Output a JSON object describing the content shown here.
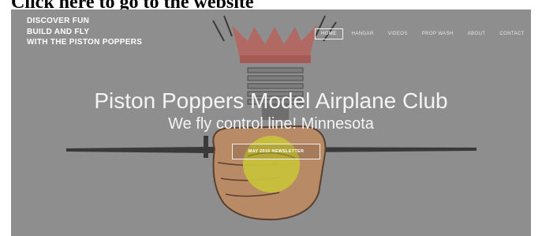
{
  "page_top_text": "Click here to go to the website",
  "header": {
    "tagline_lines": [
      "DISCOVER FUN",
      "BUILD AND FLY",
      "WITH THE PISTON POPPERS"
    ]
  },
  "nav": {
    "items": [
      {
        "label": "HOME",
        "active": true
      },
      {
        "label": "HANGAR",
        "active": false
      },
      {
        "label": "VIDEOS",
        "active": false
      },
      {
        "label": "PROP WASH",
        "active": false
      },
      {
        "label": "ABOUT",
        "active": false
      },
      {
        "label": "CONTACT",
        "active": false
      }
    ]
  },
  "hero": {
    "title": "Piston Poppers Model Airplane Club",
    "subtitle": "We fly control line!  Minnesota",
    "button_label": "MAY 2016 NEWSLETTER"
  },
  "colors": {
    "overlay": "#8e8e8e",
    "text": "#ffffff",
    "hand": "#b98a66",
    "ball": "#c9c23a",
    "crown": "#c0655e"
  }
}
